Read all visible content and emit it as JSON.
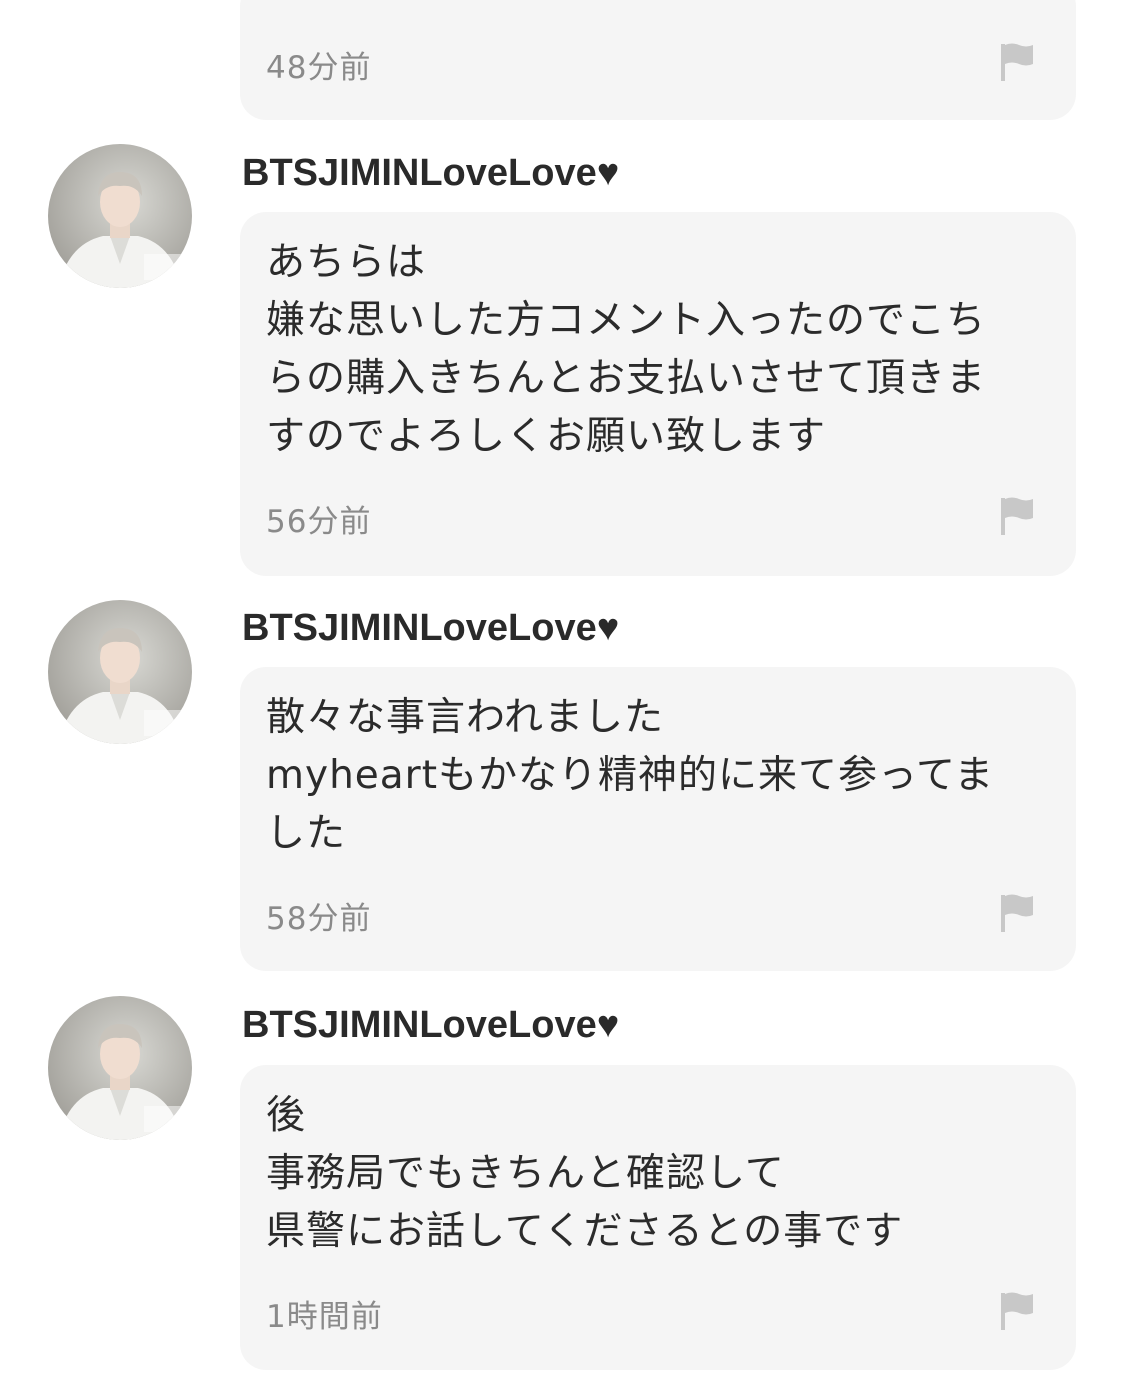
{
  "top_comment": {
    "time": "48分前"
  },
  "comments": [
    {
      "username": "BTSJIMINLoveLove♥",
      "lines": [
        "あちらは",
        "嫌な思いした方コメント入ったのでこち",
        "らの購入きちんとお支払いさせて頂きま",
        "すのでよろしくお願い致します"
      ],
      "time": "56分前"
    },
    {
      "username": "BTSJIMINLoveLove♥",
      "lines": [
        "散々な事言われました",
        "myheartもかなり精神的に来て参ってま",
        "した"
      ],
      "time": "58分前"
    },
    {
      "username": "BTSJIMINLoveLove♥",
      "lines": [
        "後",
        "事務局でもきちんと確認して",
        "県警にお話してくださるとの事です"
      ],
      "time": "1時間前"
    }
  ],
  "icons": {
    "flag": "flag-report-icon",
    "avatar": "user-avatar"
  },
  "colors": {
    "bubble_bg": "#f5f5f5",
    "time_text": "#8a8a8a",
    "flag": "#c8c8c8"
  }
}
